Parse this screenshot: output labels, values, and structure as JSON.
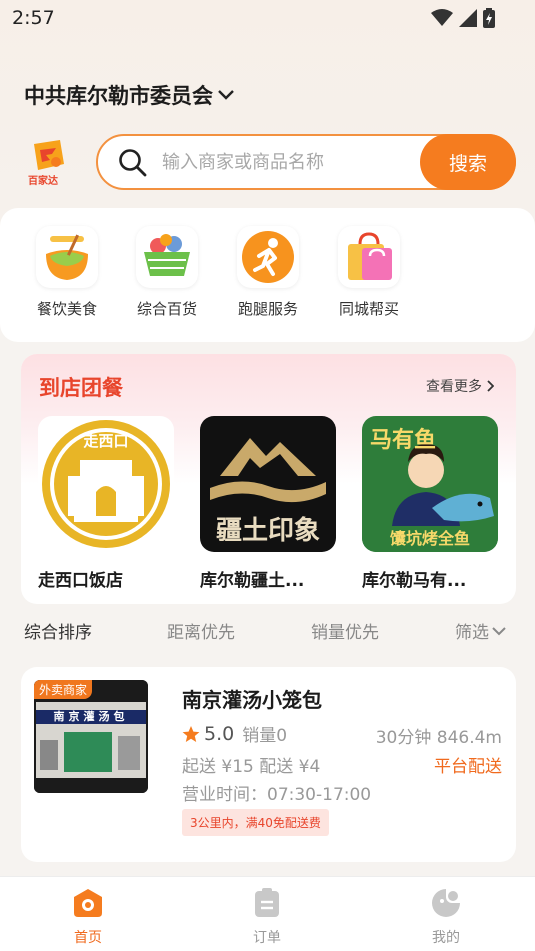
{
  "status_bar": {
    "time": "2:57"
  },
  "header": {
    "org_title": "中共库尔勒市委员会",
    "logo_text": "百家达"
  },
  "search": {
    "placeholder": "输入商家或商品名称",
    "button_label": "搜索"
  },
  "categories": [
    {
      "label": "餐饮美食",
      "icon": "noodle-bowl-icon"
    },
    {
      "label": "综合百货",
      "icon": "shopping-basket-icon"
    },
    {
      "label": "跑腿服务",
      "icon": "runner-icon"
    },
    {
      "label": "同城帮买",
      "icon": "shopping-bag-icon"
    }
  ],
  "group_dining": {
    "title": "到店团餐",
    "see_more": "查看更多",
    "shops": [
      {
        "name": "走西口饭店",
        "logo_text": "走西口"
      },
      {
        "name": "库尔勒疆土...",
        "logo_text": "疆土印象"
      },
      {
        "name": "库尔勒马有...",
        "logo_text": "马有鱼",
        "banner": "馕坑烤全鱼"
      }
    ]
  },
  "sort_bar": {
    "items": [
      "综合排序",
      "距离优先",
      "销量优先",
      "筛选"
    ]
  },
  "store": {
    "tag": "外卖商家",
    "name": "南京灌汤小笼包",
    "rating": "5.0",
    "sales": "销量0",
    "time_distance": "30分钟 846.4m",
    "min_delivery": "起送 ¥15 配送 ¥4",
    "delivery_type": "平台配送",
    "hours": "营业时间：07:30-17:00",
    "promo": "3公里内，满40免配送费",
    "sign_text": "南京灌汤包"
  },
  "bottom_nav": [
    {
      "label": "首页",
      "icon": "home-icon",
      "active": true
    },
    {
      "label": "订单",
      "icon": "order-icon",
      "active": false
    },
    {
      "label": "我的",
      "icon": "profile-icon",
      "active": false
    }
  ],
  "colors": {
    "accent": "#f57c1f",
    "title_red": "#e8452c",
    "delivery_orange": "#f06a1e"
  }
}
